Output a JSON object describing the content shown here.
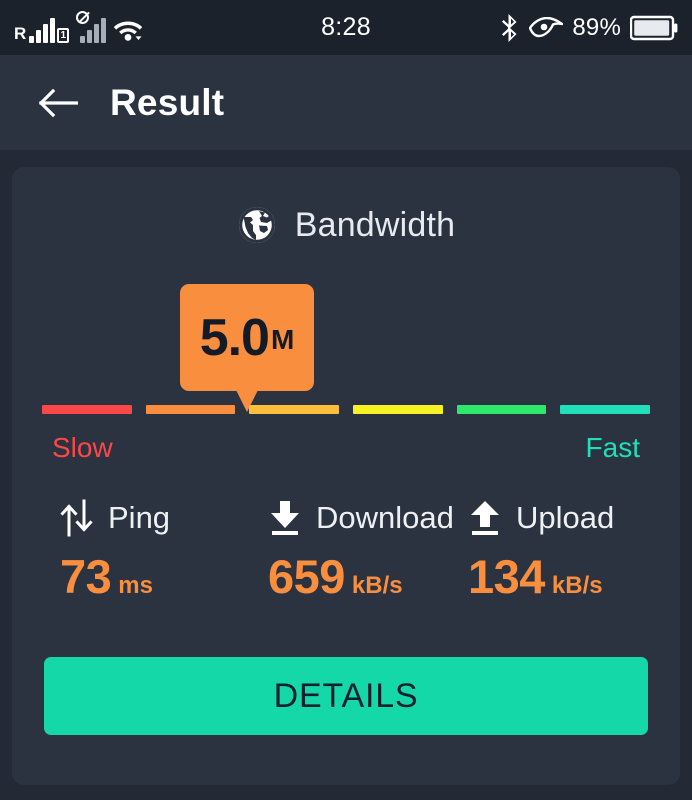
{
  "status_bar": {
    "time": "8:28",
    "battery_percent": "89%",
    "icons": [
      "roaming-signal-icon",
      "sim-no-service-icon",
      "signal-bars-icon",
      "wifi-icon",
      "bluetooth-icon",
      "eye-comfort-icon",
      "battery-icon"
    ],
    "roaming_letter": "R",
    "sim_slot_label": "1"
  },
  "app_bar": {
    "back_label": "back-arrow",
    "title": "Result"
  },
  "card": {
    "section_title": "Bandwidth",
    "section_icon": "globe-icon",
    "speed_badge": {
      "value": "5.0",
      "unit": "M"
    },
    "scale": {
      "low_label": "Slow",
      "high_label": "Fast",
      "low_color": "#fa4848",
      "high_color": "#1fe0b8",
      "segments": [
        "#fa4848",
        "#f98e3f",
        "#fcbf3c",
        "#f7f224",
        "#2ee86a",
        "#1fe0b8"
      ],
      "marker_position_percent": 34
    },
    "metrics": [
      {
        "icon": "ping-updown-arrows-icon",
        "label": "Ping",
        "value": "73",
        "unit": "ms"
      },
      {
        "icon": "download-arrow-icon",
        "label": "Download",
        "value": "659",
        "unit": "kB/s"
      },
      {
        "icon": "upload-arrow-icon",
        "label": "Upload",
        "value": "134",
        "unit": "kB/s"
      }
    ],
    "details_button": "DETAILS",
    "accent_color": "#f98e3f",
    "button_color": "#15d8a9"
  }
}
